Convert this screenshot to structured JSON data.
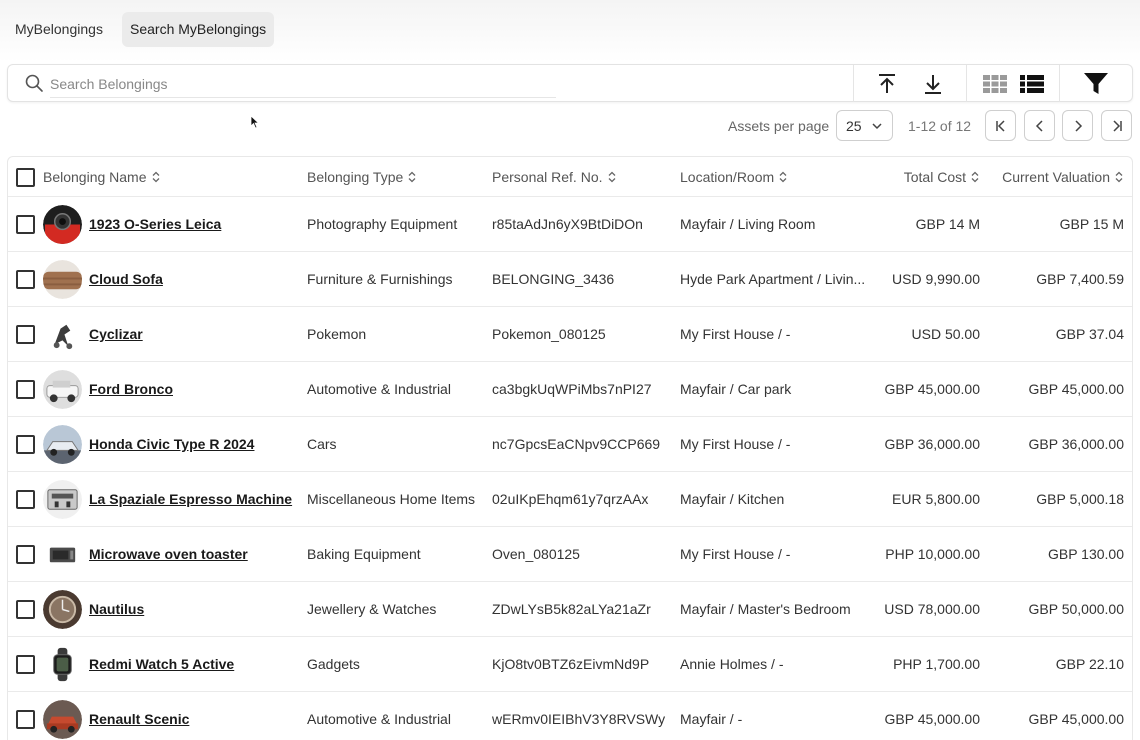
{
  "tabs": [
    {
      "label": "MyBelongings"
    },
    {
      "label": "Search MyBelongings"
    }
  ],
  "search": {
    "placeholder": "Search Belongings",
    "value": ""
  },
  "toolbar": {
    "icons": [
      "upload-icon",
      "download-icon",
      "grid-view-icon",
      "list-view-icon",
      "filter-icon"
    ]
  },
  "pagination": {
    "per_page_label": "Assets per page",
    "per_page_value": "25",
    "range": "1-12 of 12"
  },
  "table": {
    "headers": {
      "name": "Belonging Name",
      "type": "Belonging Type",
      "ref": "Personal Ref. No.",
      "location": "Location/Room",
      "cost": "Total Cost",
      "valuation": "Current Valuation"
    },
    "rows": [
      {
        "name": "1923 O-Series Leica",
        "type": "Photography Equipment",
        "ref": "r85taAdJn6yX9BtDiDOn",
        "location": "Mayfair / Living Room",
        "cost": "GBP 14 M",
        "valuation": "GBP 15 M",
        "thumb": "camera"
      },
      {
        "name": "Cloud Sofa",
        "type": "Furniture & Furnishings",
        "ref": "BELONGING_3436",
        "location": "Hyde Park Apartment / Livin...",
        "cost": "USD 9,990.00",
        "valuation": "GBP 7,400.59",
        "thumb": "sofa"
      },
      {
        "name": "Cyclizar",
        "type": "Pokemon",
        "ref": "Pokemon_080125",
        "location": "My First House / -",
        "cost": "USD 50.00",
        "valuation": "GBP 37.04",
        "thumb": "pokemon"
      },
      {
        "name": "Ford Bronco",
        "type": "Automotive & Industrial",
        "ref": "ca3bgkUqWPiMbs7nPI27",
        "location": "Mayfair / Car park",
        "cost": "GBP 45,000.00",
        "valuation": "GBP 45,000.00",
        "thumb": "car-white"
      },
      {
        "name": "Honda Civic Type R 2024",
        "type": "Cars",
        "ref": "nc7GpcsEaCNpv9CCP669",
        "location": "My First House / -",
        "cost": "GBP 36,000.00",
        "valuation": "GBP 36,000.00",
        "thumb": "car-blue"
      },
      {
        "name": "La Spaziale Espresso Machine",
        "type": "Miscellaneous Home Items",
        "ref": "02uIKpEhqm61y7qrzAAx",
        "location": "Mayfair / Kitchen",
        "cost": "EUR 5,800.00",
        "valuation": "GBP 5,000.18",
        "thumb": "espresso"
      },
      {
        "name": "Microwave oven toaster",
        "type": "Baking Equipment",
        "ref": "Oven_080125",
        "location": "My First House / -",
        "cost": "PHP 10,000.00",
        "valuation": "GBP 130.00",
        "thumb": "oven"
      },
      {
        "name": "Nautilus",
        "type": "Jewellery & Watches",
        "ref": "ZDwLYsB5k82aLYa21aZr",
        "location": "Mayfair / Master's Bedroom",
        "cost": "USD 78,000.00",
        "valuation": "GBP 50,000.00",
        "thumb": "watch"
      },
      {
        "name": "Redmi Watch 5 Active",
        "type": "Gadgets",
        "ref": "KjO8tv0BTZ6zEivmNd9P",
        "location": "Annie Holmes / -",
        "cost": "PHP 1,700.00",
        "valuation": "GBP 22.10",
        "thumb": "smartwatch"
      },
      {
        "name": "Renault Scenic",
        "type": "Automotive & Industrial",
        "ref": "wERmv0IEIBhV3Y8RVSWy",
        "location": "Mayfair / -",
        "cost": "GBP 45,000.00",
        "valuation": "GBP 45,000.00",
        "thumb": "car-red"
      }
    ]
  }
}
